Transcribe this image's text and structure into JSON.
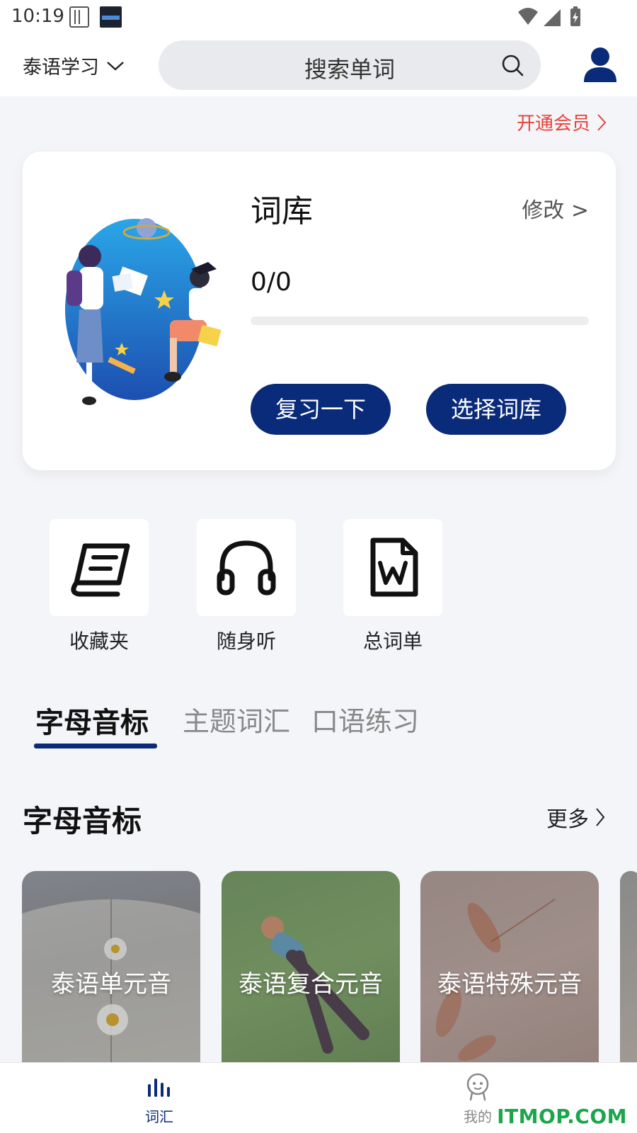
{
  "status_bar": {
    "time": "10:19"
  },
  "header": {
    "language": "泰语学习",
    "search_placeholder": "搜索单词"
  },
  "vip": {
    "label": "开通会员"
  },
  "vocab_card": {
    "title": "词库",
    "edit_label": "修改 >",
    "progress_text": "0/0",
    "progress_value": 0,
    "review_button": "复习一下",
    "select_button": "选择词库"
  },
  "tools": [
    {
      "label": "收藏夹",
      "icon": "book-icon"
    },
    {
      "label": "随身听",
      "icon": "headphones-icon"
    },
    {
      "label": "总词单",
      "icon": "word-file-icon"
    }
  ],
  "tabs": [
    {
      "label": "字母音标",
      "active": true
    },
    {
      "label": "主题词汇",
      "active": false
    },
    {
      "label": "口语练习",
      "active": false
    }
  ],
  "section": {
    "title": "字母音标",
    "more_label": "更多"
  },
  "cards": [
    {
      "label": "泰语单元音"
    },
    {
      "label": "泰语复合元音"
    },
    {
      "label": "泰语特殊元音"
    }
  ],
  "bottom_nav": [
    {
      "label": "词汇",
      "icon": "chart-bars-icon",
      "active": true
    },
    {
      "label": "我的",
      "icon": "robot-face-icon",
      "active": false
    }
  ],
  "watermark": "ITMOP.COM",
  "colors": {
    "primary": "#0a2a7a",
    "vip": "#e8433a",
    "background": "#f4f5f9"
  }
}
